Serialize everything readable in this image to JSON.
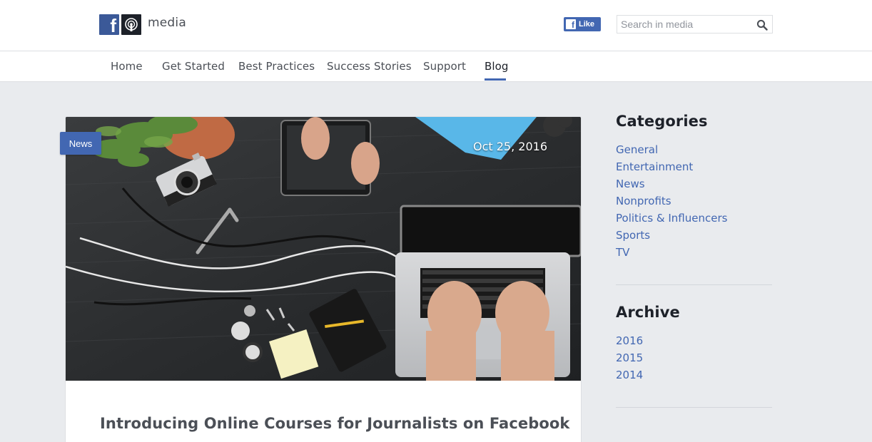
{
  "header": {
    "brand": "media",
    "like_label": "Like",
    "search_placeholder": "Search in media",
    "search_icon": "search-icon"
  },
  "nav": {
    "items": [
      {
        "label": "Home"
      },
      {
        "label": "Get Started"
      },
      {
        "label": "Best Practices"
      },
      {
        "label": "Success Stories"
      },
      {
        "label": "Support"
      },
      {
        "label": "Blog"
      }
    ],
    "active": "Blog"
  },
  "post": {
    "badge": "News",
    "date": "Oct 25, 2016",
    "title": "Introducing Online Courses for Journalists on Facebook"
  },
  "sidebar": {
    "categories_title": "Categories",
    "categories": [
      "General",
      "Entertainment",
      "News",
      "Nonprofits",
      "Politics & Influencers",
      "Sports",
      "TV"
    ],
    "archive_title": "Archive",
    "archive": [
      "2016",
      "2015",
      "2014"
    ]
  },
  "colors": {
    "brand_blue": "#4267b2",
    "page_bg": "#e9ebee",
    "text_dark": "#1d2129",
    "text_muted": "#4b4f56"
  }
}
